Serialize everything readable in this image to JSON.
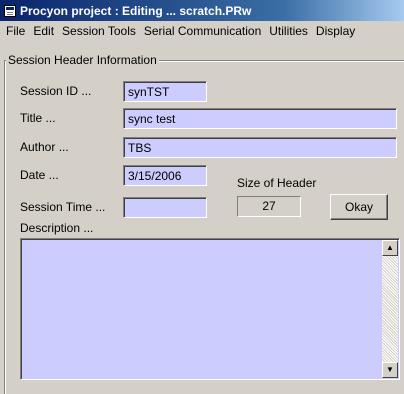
{
  "window": {
    "title": "Procyon project : Editing ... scratch.PRw",
    "icon": "app-icon"
  },
  "menu": [
    "File",
    "Edit",
    "Session Tools",
    "Serial Communication",
    "Utilities",
    "Display"
  ],
  "group": {
    "title": "Session Header Information"
  },
  "fields": {
    "session_id": {
      "label": "Session ID ...",
      "value": "synTST"
    },
    "title": {
      "label": "Title ...",
      "value": "sync test"
    },
    "author": {
      "label": "Author ...",
      "value": "TBS"
    },
    "date": {
      "label": "Date ...",
      "value": "3/15/2006"
    },
    "session_time": {
      "label": "Session Time ...",
      "value": ""
    },
    "description": {
      "label": "Description ...",
      "value": ""
    }
  },
  "header_size": {
    "label": "Size of Header",
    "value": "27"
  },
  "okay_button": {
    "label": "Okay"
  },
  "colors": {
    "field_bg": "#ccccff",
    "face": "#d4d0c8",
    "title_active": "#0a246a"
  }
}
